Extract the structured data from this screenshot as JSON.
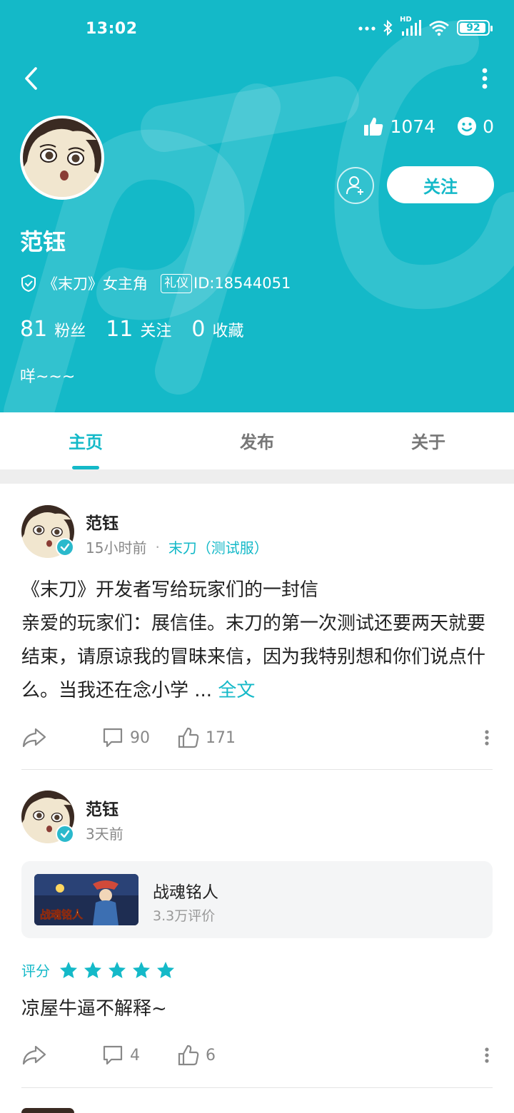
{
  "colors": {
    "accent": "#14b9c8",
    "text": "#222222",
    "muted": "#888888"
  },
  "status_bar": {
    "time": "13:02",
    "battery": "92",
    "network_label": "HD"
  },
  "profile": {
    "name": "范钰",
    "likes": "1074",
    "emoji_count": "0",
    "follow_label": "关注",
    "role": "《末刀》女主角",
    "badge": "礼仪",
    "user_id": "ID:18544051",
    "fans_count": "81",
    "fans_label": "粉丝",
    "following_count": "11",
    "following_label": "关注",
    "favorites_count": "0",
    "favorites_label": "收藏",
    "bio": "咩~~~"
  },
  "tabs": [
    {
      "label": "主页",
      "active": true
    },
    {
      "label": "发布",
      "active": false
    },
    {
      "label": "关于",
      "active": false
    }
  ],
  "posts": [
    {
      "author": "范钰",
      "time": "15小时前",
      "game_link": "末刀（测试服）",
      "title": "《末刀》开发者写给玩家们的一封信",
      "body": "亲爱的玩家们：展信佳。末刀的第一次测试还要两天就要结束，请原谅我的冒昧来信，因为我特别想和你们说点什么。当我还在念小学 ...",
      "read_more": "全文",
      "comments": "90",
      "likes": "171"
    },
    {
      "author": "范钰",
      "time": "3天前",
      "game": {
        "name": "战魂铭人",
        "reviews": "3.3万评价"
      },
      "rating_label": "评分",
      "rating": 5,
      "body": "凉屋牛逼不解释~",
      "comments": "4",
      "likes": "6"
    }
  ]
}
